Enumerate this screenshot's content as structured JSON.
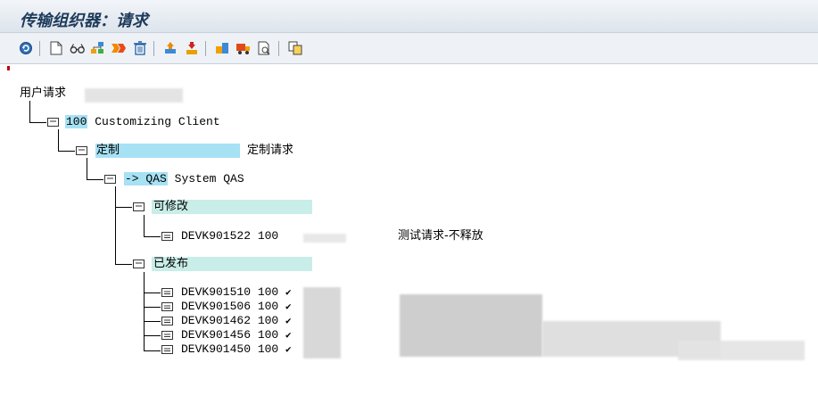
{
  "window": {
    "title": "传输组织器：请求"
  },
  "toolbar": {
    "buttons": [
      {
        "name": "refresh-icon"
      },
      {
        "name": "new-document-icon"
      },
      {
        "name": "glasses-icon"
      },
      {
        "name": "hierarchy-icon"
      },
      {
        "name": "release-icon"
      },
      {
        "name": "trash-icon"
      },
      {
        "name": "move-up-icon"
      },
      {
        "name": "import-icon"
      },
      {
        "name": "transport-icon"
      },
      {
        "name": "truck-icon"
      },
      {
        "name": "search-doc-icon"
      },
      {
        "name": "copy-icon"
      }
    ]
  },
  "tree": {
    "root_label": "用户请求",
    "client": {
      "number": "100",
      "label": "Customizing Client"
    },
    "customizing": {
      "label": "定制",
      "desc": "定制请求"
    },
    "target": {
      "arrow": "->",
      "system": "QAS",
      "label": "System QAS"
    },
    "modifiable": {
      "label": "可修改",
      "items": [
        {
          "id": "DEVK901522",
          "client": "100",
          "desc": "测试请求-不释放"
        }
      ]
    },
    "released": {
      "label": "已发布",
      "items": [
        {
          "id": "DEVK901510",
          "client": "100",
          "status": "✔"
        },
        {
          "id": "DEVK901506",
          "client": "100",
          "status": "✔"
        },
        {
          "id": "DEVK901462",
          "client": "100",
          "status": "✔"
        },
        {
          "id": "DEVK901456",
          "client": "100",
          "status": "✔"
        },
        {
          "id": "DEVK901450",
          "client": "100",
          "status": "✔"
        }
      ]
    }
  }
}
